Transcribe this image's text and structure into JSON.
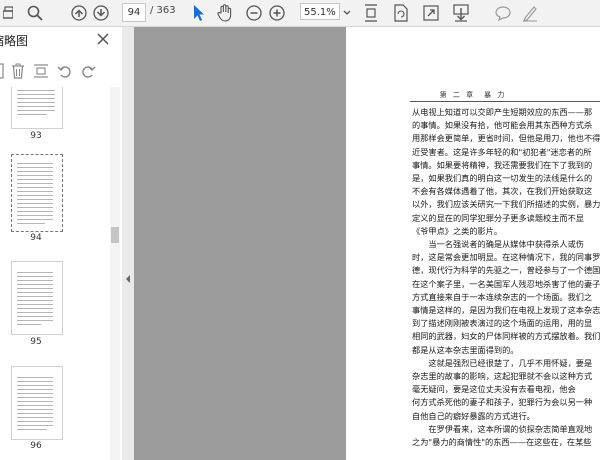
{
  "toolbar": {
    "current_page": "94",
    "total_pages": "/ 363",
    "zoom": "55.1%"
  },
  "sidebar": {
    "title": "缩略图",
    "thumbnails": [
      {
        "label": "93",
        "selected": false
      },
      {
        "label": "94",
        "selected": true
      },
      {
        "label": "95",
        "selected": false
      },
      {
        "label": "96",
        "selected": false
      }
    ]
  },
  "document": {
    "running_head": "第 二 章　暴 力",
    "lines": [
      "从电视上知道可以交即产生短期效应的东西——那",
      "的事情。如果没有拾，他可能会用其东西种方式杀",
      "用那样会更简单，更省时间，但他是用刀，他也不得",
      "近受害者。这是许多年轻的和\"初犯者\"迷恋者的所",
      "事情。如果要将精神，我还需要我们在下了我到的",
      "是，如果我们真的明白这一切发生的法线是什么的",
      "不会有各媒体遇着了他，其次，在我们开始获取这",
      "以外，我们应该关研究一下我们所描述的实例，暴力",
      "定义的显在的同学犯罪分子更多读题校主而不显",
      "《爷甲点》之类的影片。",
      "　　当一名强说者的确是从媒体中获得杀人或伤",
      "时，这是常会更加明显。在这种情况下，我的同事罗伊·",
      "德，现代行为科学的先驱之一，曾经参与了一个德国",
      "在这个案子里，一名美国军人残忍地杀害了他的妻子",
      "方式直接来自于一本连续杂志的一个场面。我们之",
      "事情是这样的，是因为我们在电视上发现了这本杂志",
      "到了描述刚刚被表演过的这个场面的运用，用的显",
      "相同的武器，妇女的尸体同样被的方式摆放着。我们",
      "都是从这本杂志里面得到的。",
      "　　这就是强烈已经很楚了，几乎不用怀疑，要是",
      "杂志里的故事的影响，这起犯罪就不会以这种方式",
      "毫无疑问，要是这位丈夫没有去看电视，他会",
      "何方式杀死他的妻子和孩子，犯罪行为会以另一种",
      "自他自己的癖好暴露的方式进行。",
      "　　在罗伊看来，这本所谓的侦探杂志简单直观地",
      "之为\"暴力的商情性\"的东西——在这些在，在某些"
    ]
  }
}
